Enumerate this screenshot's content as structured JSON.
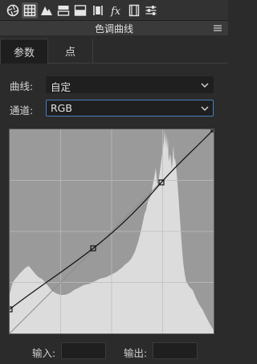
{
  "toolbar": {
    "tools": [
      {
        "icon": "aperture-icon"
      },
      {
        "icon": "grid-icon"
      },
      {
        "icon": "mountains-icon"
      },
      {
        "icon": "split-toning-icon"
      },
      {
        "icon": "detail-icon"
      },
      {
        "icon": "lens-icon"
      },
      {
        "icon": "fx-icon"
      },
      {
        "icon": "film-icon"
      },
      {
        "icon": "sliders-icon"
      }
    ]
  },
  "panel": {
    "title": "色调曲线"
  },
  "tabs": {
    "params": "参数",
    "point": "点"
  },
  "curve_row": {
    "label": "曲线:",
    "value": "自定"
  },
  "channel_row": {
    "label": "通道:",
    "value": "RGB"
  },
  "io": {
    "input_label": "输入:",
    "output_label": "输出:",
    "input_value": "",
    "output_value": ""
  },
  "colors": {
    "graph_bg": "#9a9a9a",
    "histogram": "#dcdcdc",
    "focus": "#4a7ec2"
  }
}
